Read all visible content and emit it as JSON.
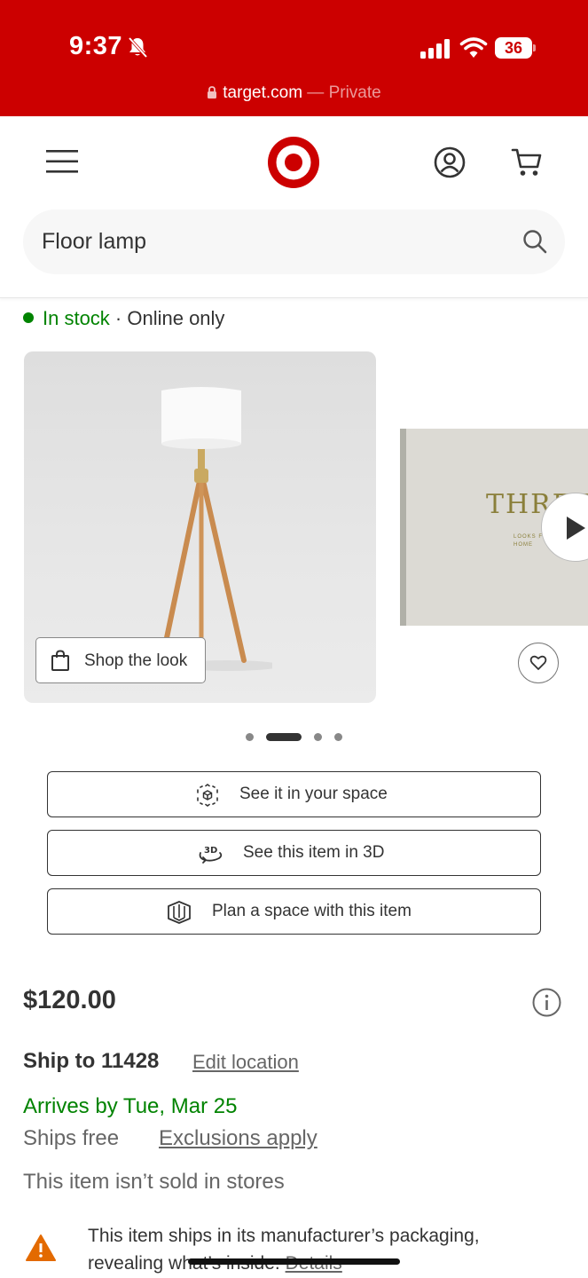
{
  "status_bar": {
    "time": "9:37",
    "battery": "36",
    "url_host": "target.com",
    "url_suffix": " — Private"
  },
  "header": {
    "search_value": "Floor lamp",
    "brand_color": "#cc0000"
  },
  "product": {
    "stock_status": "In stock",
    "stock_separator": " · Online only",
    "shop_the_look_label": "Shop the look",
    "second_image_title": "THREE",
    "second_image_sub": "LOOKS FOR EVERY HOME",
    "gallery": {
      "total": 4,
      "active_index": 1
    },
    "actions": [
      {
        "label": "See it in your space",
        "icon": "ar-cube-icon"
      },
      {
        "label": "See this item in 3D",
        "icon": "3d-rotate-icon"
      },
      {
        "label": "Plan a space with this item",
        "icon": "room-plan-icon"
      }
    ],
    "price": "$120.00",
    "ship_to": "Ship to 11428",
    "edit_location": "Edit location",
    "arrives": "Arrives by Tue, Mar 25",
    "ships_free": "Ships free",
    "exclusions": "Exclusions apply",
    "not_in_stores": "This item isn’t sold in stores",
    "packaging_note": "This item ships in its manufacturer’s packaging, revealing what’s inside.",
    "details_link": "Details"
  },
  "colors": {
    "in_stock_green": "#008300",
    "warning_orange": "#e36a00"
  }
}
